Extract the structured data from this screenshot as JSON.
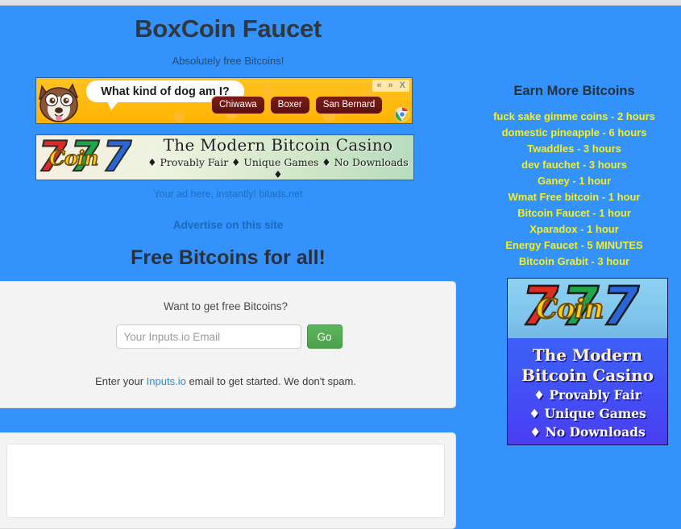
{
  "header": {
    "title": "BoxCoin Faucet",
    "subtitle": "Absolutely free Bitcoins!"
  },
  "ads": {
    "dog_banner": {
      "question": "What kind of dog am I?",
      "answers": [
        "Chiwawa",
        "Boxer",
        "San Bernard"
      ],
      "controls": [
        "«",
        "»",
        "X"
      ]
    },
    "coin_banner": {
      "logo_digits": [
        "7",
        "7",
        "7"
      ],
      "logo_word": "Coin",
      "tagline": "The Modern Bitcoin Casino",
      "features": "♦ Provably Fair ♦ Unique Games ♦ No Downloads ♦"
    },
    "bitads_text": "Your ad here, instantly! bitads.net",
    "advertise_link": "Advertise on this site"
  },
  "main": {
    "free_heading": "Free Bitcoins for all!",
    "card": {
      "question": "Want to get free Bitcoins?",
      "email_placeholder": "Your Inputs.io Email",
      "email_value": "",
      "go_label": "Go",
      "note_prefix": "Enter your ",
      "note_link": "Inputs.io",
      "note_suffix": " email to get started. We don't spam."
    }
  },
  "sidebar": {
    "heading": "Earn More Bitcoins",
    "links": [
      "fuck sake gimme coins - 2 hours",
      "domestic pineapple - 6 hours",
      "Twaddles - 3 hours",
      "dev fauchet - 3 hours",
      "Ganey - 1 hour",
      "Wmat Free bitcoin - 1 hour",
      "Bitcoin Faucet - 1 hour",
      "Xparadox - 1 hour",
      "Energy Faucet - 5 MINUTES",
      "Bitcoin Grabit - 3 hour"
    ],
    "casino_ad": {
      "logo_digits": [
        "7",
        "7",
        "7"
      ],
      "logo_word": "Coin",
      "line1": "The Modern",
      "line2": "Bitcoin Casino",
      "features": [
        "♦ Provably Fair",
        "♦ Unique Games",
        "♦ No Downloads"
      ]
    }
  },
  "colors": {
    "page_background": "#3392fb",
    "sidebar_link": "#f2ef2c",
    "go_button": "#5cb85c",
    "heading_text": "#2a3036"
  }
}
